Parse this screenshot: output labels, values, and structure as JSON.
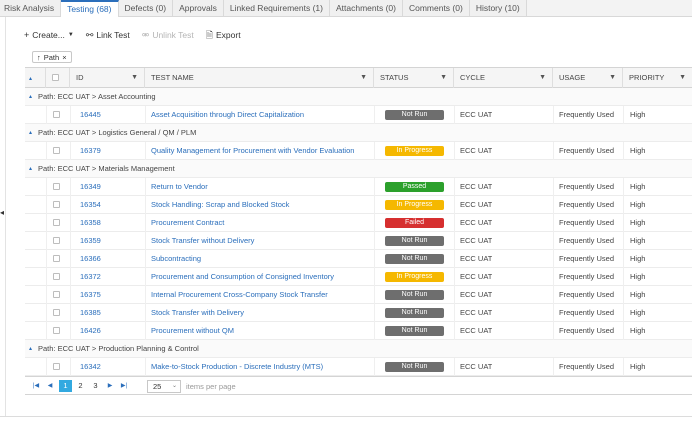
{
  "tabs": [
    {
      "label": "Risk Analysis",
      "active": false
    },
    {
      "label": "Testing (68)",
      "active": true
    },
    {
      "label": "Defects (0)",
      "active": false
    },
    {
      "label": "Approvals",
      "active": false
    },
    {
      "label": "Linked Requirements (1)",
      "active": false
    },
    {
      "label": "Attachments (0)",
      "active": false
    },
    {
      "label": "Comments (0)",
      "active": false
    },
    {
      "label": "History (10)",
      "active": false
    }
  ],
  "toolbar": {
    "create_label": "Create...",
    "link_test_label": "Link Test",
    "unlink_test_label": "Unlink Test",
    "export_label": "Export"
  },
  "group_chip": {
    "label": "Path"
  },
  "columns": {
    "id": "ID",
    "test_name": "TEST NAME",
    "status": "STATUS",
    "cycle": "CYCLE",
    "usage": "USAGE",
    "priority": "PRIORITY"
  },
  "status_colors": {
    "Not Run": "#6e6e6e",
    "In Progress": "#f5b800",
    "Passed": "#2ca02c",
    "Failed": "#d62f2f"
  },
  "rows": [
    {
      "type": "group",
      "label": "Path: ECC UAT > Asset Accounting"
    },
    {
      "type": "item",
      "id": "16445",
      "name": "Asset Acquisition through Direct Capitalization",
      "status": "Not Run",
      "cycle": "ECC UAT",
      "usage": "Frequently Used",
      "priority": "High"
    },
    {
      "type": "group",
      "label": "Path: ECC UAT > Logistics General / QM / PLM"
    },
    {
      "type": "item",
      "id": "16379",
      "name": "Quality Management for Procurement with Vendor Evaluation",
      "status": "In Progress",
      "cycle": "ECC UAT",
      "usage": "Frequently Used",
      "priority": "High"
    },
    {
      "type": "group",
      "label": "Path: ECC UAT > Materials Management"
    },
    {
      "type": "item",
      "id": "16349",
      "name": "Return to Vendor",
      "status": "Passed",
      "cycle": "ECC UAT",
      "usage": "Frequently Used",
      "priority": "High"
    },
    {
      "type": "item",
      "id": "16354",
      "name": "Stock Handling: Scrap and Blocked Stock",
      "status": "In Progress",
      "cycle": "ECC UAT",
      "usage": "Frequently Used",
      "priority": "High"
    },
    {
      "type": "item",
      "id": "16358",
      "name": "Procurement Contract",
      "status": "Failed",
      "cycle": "ECC UAT",
      "usage": "Frequently Used",
      "priority": "High"
    },
    {
      "type": "item",
      "id": "16359",
      "name": "Stock Transfer without Delivery",
      "status": "Not Run",
      "cycle": "ECC UAT",
      "usage": "Frequently Used",
      "priority": "High"
    },
    {
      "type": "item",
      "id": "16366",
      "name": "Subcontracting",
      "status": "Not Run",
      "cycle": "ECC UAT",
      "usage": "Frequently Used",
      "priority": "High"
    },
    {
      "type": "item",
      "id": "16372",
      "name": "Procurement and Consumption of Consigned Inventory",
      "status": "In Progress",
      "cycle": "ECC UAT",
      "usage": "Frequently Used",
      "priority": "High"
    },
    {
      "type": "item",
      "id": "16375",
      "name": "Internal Procurement Cross-Company Stock Transfer",
      "status": "Not Run",
      "cycle": "ECC UAT",
      "usage": "Frequently Used",
      "priority": "High"
    },
    {
      "type": "item",
      "id": "16385",
      "name": "Stock Transfer with Delivery",
      "status": "Not Run",
      "cycle": "ECC UAT",
      "usage": "Frequently Used",
      "priority": "High"
    },
    {
      "type": "item",
      "id": "16426",
      "name": "Procurement without QM",
      "status": "Not Run",
      "cycle": "ECC UAT",
      "usage": "Frequently Used",
      "priority": "High"
    },
    {
      "type": "group",
      "label": "Path: ECC UAT > Production Planning & Control"
    },
    {
      "type": "item",
      "id": "16342",
      "name": "Make-to-Stock Production - Discrete Industry (MTS)",
      "status": "Not Run",
      "cycle": "ECC UAT",
      "usage": "Frequently Used",
      "priority": "High"
    }
  ],
  "pager": {
    "pages": [
      "1",
      "2",
      "3"
    ],
    "current": "1",
    "page_size": "25",
    "items_per_page_label": "items per page"
  }
}
